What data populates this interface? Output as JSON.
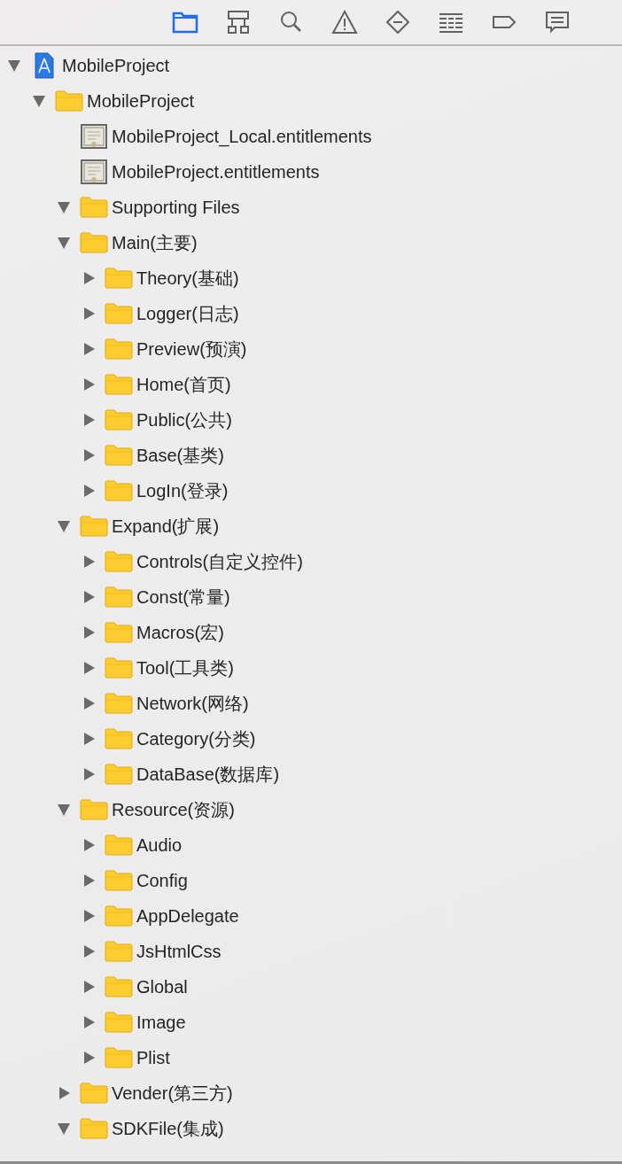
{
  "toolbar": {
    "tabs": [
      {
        "kind": "folder",
        "selected": true
      },
      {
        "kind": "hierarchy",
        "selected": false
      },
      {
        "kind": "search",
        "selected": false
      },
      {
        "kind": "warning",
        "selected": false
      },
      {
        "kind": "breakpoint",
        "selected": false
      },
      {
        "kind": "list",
        "selected": false
      },
      {
        "kind": "tag",
        "selected": false
      },
      {
        "kind": "message",
        "selected": false
      }
    ]
  },
  "tree": [
    {
      "kind": "project",
      "label": "MobileProject",
      "expanded": true,
      "children": [
        {
          "kind": "folder",
          "label": "MobileProject",
          "expanded": true,
          "children": [
            {
              "kind": "file",
              "label": "MobileProject_Local.entitlements"
            },
            {
              "kind": "file",
              "label": "MobileProject.entitlements"
            },
            {
              "kind": "folder",
              "label": "Supporting Files",
              "expanded": true
            },
            {
              "kind": "folder",
              "label": "Main(主要)",
              "expanded": true,
              "children": [
                {
                  "kind": "folder",
                  "label": "Theory(基础)",
                  "expanded": false
                },
                {
                  "kind": "folder",
                  "label": "Logger(日志)",
                  "expanded": false
                },
                {
                  "kind": "folder",
                  "label": "Preview(预演)",
                  "expanded": false
                },
                {
                  "kind": "folder",
                  "label": "Home(首页)",
                  "expanded": false
                },
                {
                  "kind": "folder",
                  "label": "Public(公共)",
                  "expanded": false
                },
                {
                  "kind": "folder",
                  "label": "Base(基类)",
                  "expanded": false
                },
                {
                  "kind": "folder",
                  "label": "LogIn(登录)",
                  "expanded": false
                }
              ]
            },
            {
              "kind": "folder",
              "label": "Expand(扩展)",
              "expanded": true,
              "children": [
                {
                  "kind": "folder",
                  "label": "Controls(自定义控件)",
                  "expanded": false
                },
                {
                  "kind": "folder",
                  "label": "Const(常量)",
                  "expanded": false
                },
                {
                  "kind": "folder",
                  "label": "Macros(宏)",
                  "expanded": false
                },
                {
                  "kind": "folder",
                  "label": "Tool(工具类)",
                  "expanded": false
                },
                {
                  "kind": "folder",
                  "label": "Network(网络)",
                  "expanded": false
                },
                {
                  "kind": "folder",
                  "label": "Category(分类)",
                  "expanded": false
                },
                {
                  "kind": "folder",
                  "label": "DataBase(数据库)",
                  "expanded": false
                }
              ]
            },
            {
              "kind": "folder",
              "label": "Resource(资源)",
              "expanded": true,
              "children": [
                {
                  "kind": "folder",
                  "label": "Audio",
                  "expanded": false
                },
                {
                  "kind": "folder",
                  "label": "Config",
                  "expanded": false
                },
                {
                  "kind": "folder",
                  "label": "AppDelegate",
                  "expanded": false
                },
                {
                  "kind": "folder",
                  "label": "JsHtmlCss",
                  "expanded": false
                },
                {
                  "kind": "folder",
                  "label": "Global",
                  "expanded": false
                },
                {
                  "kind": "folder",
                  "label": "Image",
                  "expanded": false
                },
                {
                  "kind": "folder",
                  "label": "Plist",
                  "expanded": false
                }
              ]
            },
            {
              "kind": "folder",
              "label": "Vender(第三方)",
              "expanded": false
            },
            {
              "kind": "folder",
              "label": "SDKFile(集成)",
              "expanded": true
            }
          ]
        }
      ]
    }
  ]
}
